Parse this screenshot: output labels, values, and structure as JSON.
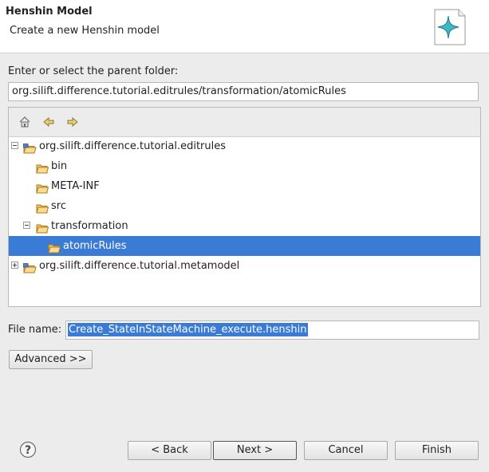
{
  "header": {
    "title": "Henshin Model",
    "subtitle": "Create a new Henshin model"
  },
  "parent_folder": {
    "label": "Enter or select the parent folder:",
    "value": "org.silift.difference.tutorial.editrules/transformation/atomicRules"
  },
  "tree": {
    "toolbar": [
      "home-icon",
      "back-arrow-icon",
      "forward-arrow-icon"
    ],
    "items": [
      {
        "label": "org.silift.difference.tutorial.editrules",
        "expander": "minus",
        "icon": "project-folder-icon"
      },
      {
        "label": "bin",
        "icon": "folder-icon"
      },
      {
        "label": "META-INF",
        "icon": "folder-icon"
      },
      {
        "label": "src",
        "icon": "folder-icon"
      },
      {
        "label": "transformation",
        "expander": "minus",
        "icon": "folder-icon"
      },
      {
        "label": "atomicRules",
        "icon": "folder-icon",
        "selected": true
      },
      {
        "label": "org.silift.difference.tutorial.metamodel",
        "expander": "plus",
        "icon": "project-folder-icon"
      }
    ]
  },
  "file": {
    "label": "File name:",
    "value": "Create_StateInStateMachine_execute.henshin"
  },
  "advanced_label": "Advanced >>",
  "footer": {
    "back": "< Back",
    "next": "Next >",
    "cancel": "Cancel",
    "finish": "Finish"
  },
  "colors": {
    "selection": "#3a7bd5",
    "folder": "#e8a33d",
    "wizard_star": "#3fb8c6"
  }
}
